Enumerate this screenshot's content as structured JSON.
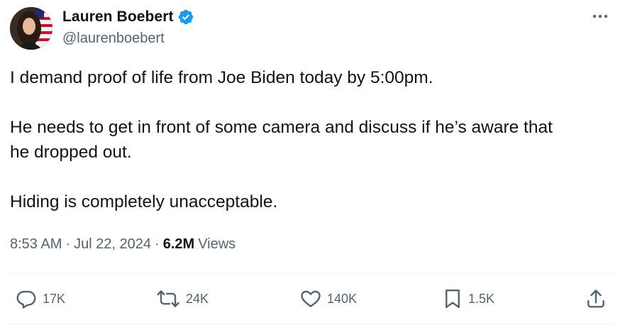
{
  "author": {
    "display_name": "Lauren Boebert",
    "handle": "@laurenboebert"
  },
  "tweet": {
    "paragraphs": [
      "I demand proof of life from Joe Biden today by 5:00pm.",
      "He needs to get in front of some camera and discuss if he’s aware that\nhe dropped out.",
      "Hiding is completely unacceptable."
    ],
    "time": "8:53 AM",
    "date": "Jul 22, 2024",
    "views_count": "6.2M",
    "views_label": "Views"
  },
  "actions": {
    "replies": "17K",
    "reposts": "24K",
    "likes": "140K",
    "bookmarks": "1.5K"
  },
  "icons": {
    "verified": "verified-badge-icon",
    "more": "more-icon",
    "reply": "reply-icon",
    "repost": "repost-icon",
    "like": "heart-icon",
    "bookmark": "bookmark-icon",
    "share": "share-icon"
  },
  "colors": {
    "accent": "#1d9bf0",
    "secondary_text": "#536471",
    "primary_text": "#0f1419",
    "divider": "#eff3f4"
  }
}
